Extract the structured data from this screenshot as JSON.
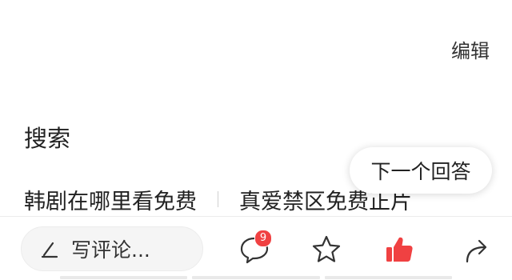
{
  "header": {
    "edit_label": "编辑"
  },
  "search": {
    "title": "搜索",
    "suggestions": [
      "韩剧在哪里看免费",
      "真爱禁区免费正片"
    ]
  },
  "floating": {
    "next_answer_label": "下一个回答"
  },
  "bottom_bar": {
    "comment_placeholder": "写评论...",
    "comment_count_badge": "9",
    "icons": {
      "comment": "comment-bubble-icon",
      "favorite": "star-icon",
      "like": "thumbs-up-icon",
      "share": "share-arrow-icon",
      "pen": "pen-icon"
    },
    "colors": {
      "like_active": "#f04142",
      "badge": "#f04142"
    }
  }
}
